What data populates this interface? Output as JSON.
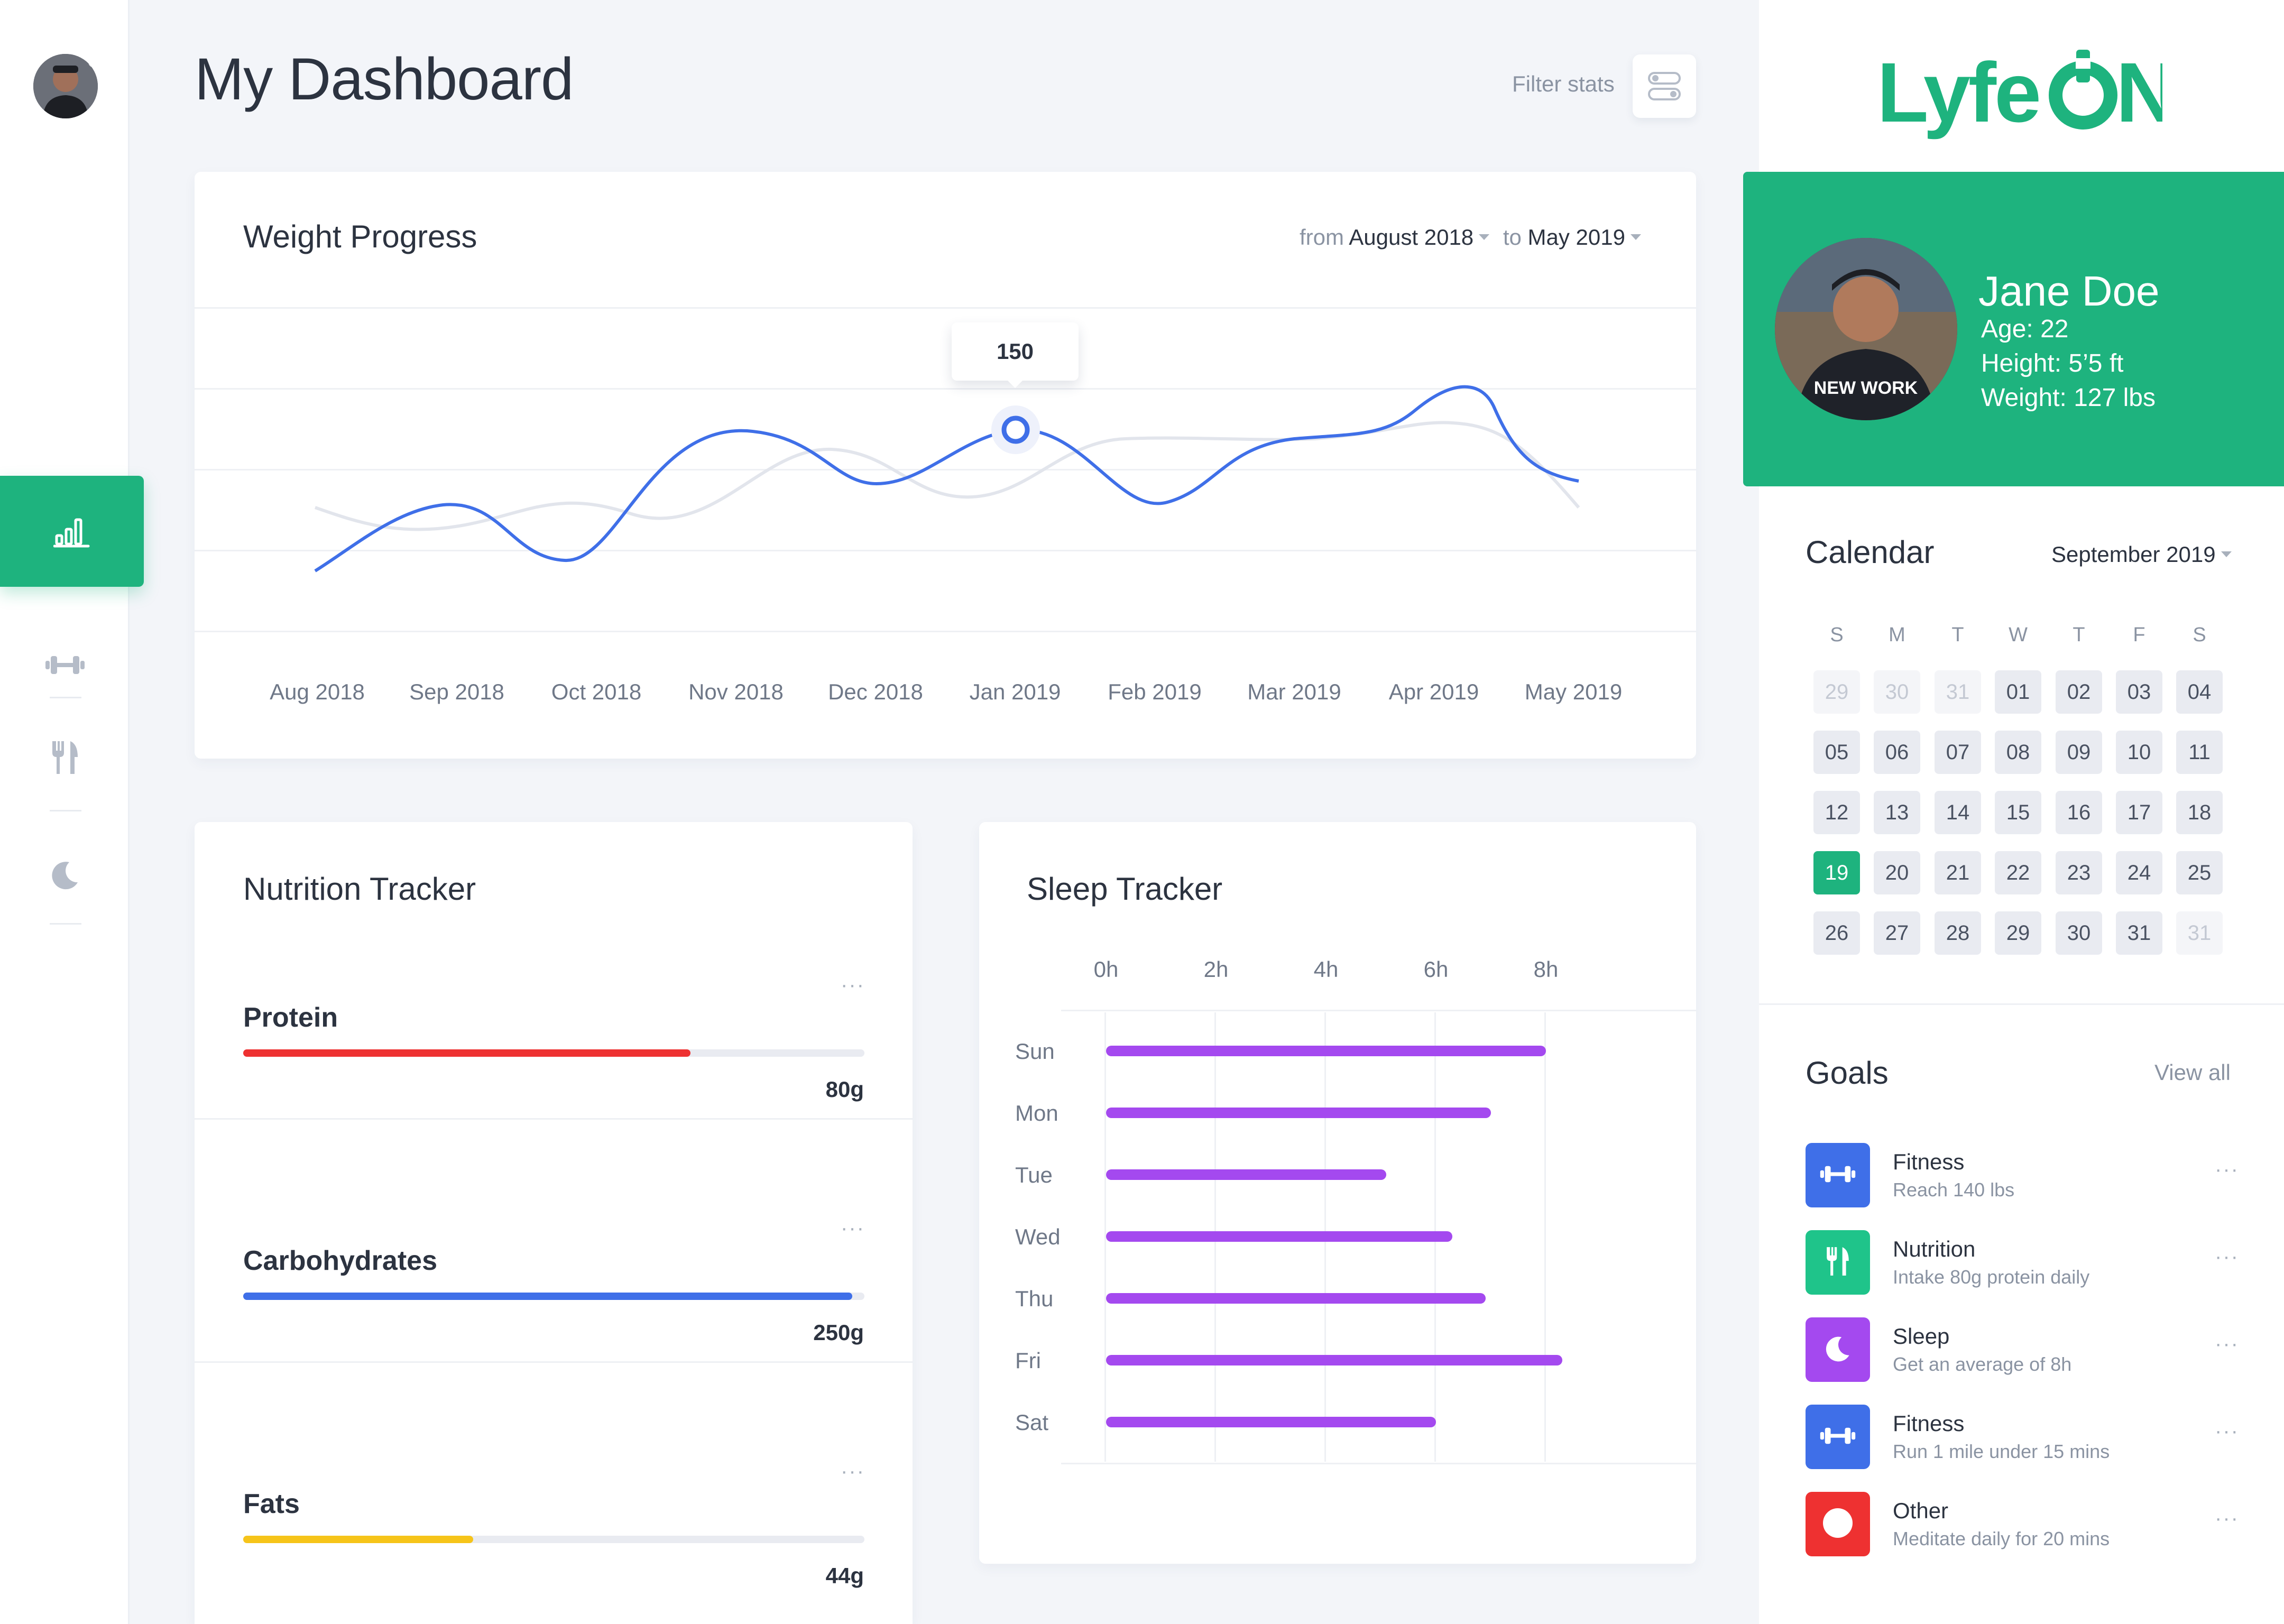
{
  "header": {
    "title": "My Dashboard",
    "filter_label": "Filter stats"
  },
  "rail": {
    "items": [
      "stats-icon",
      "dumbbell-icon",
      "fork-knife-icon",
      "moon-icon"
    ]
  },
  "weight": {
    "title": "Weight Progress",
    "from_label": "from",
    "from_value": "August 2018",
    "to_label": "to",
    "to_value": "May 2019",
    "tooltip": "150",
    "months": [
      "Aug 2018",
      "Sep 2018",
      "Oct 2018",
      "Nov 2018",
      "Dec 2018",
      "Jan 2019",
      "Feb 2019",
      "Mar 2019",
      "Apr 2019",
      "May 2019"
    ]
  },
  "nutrition": {
    "title": "Nutrition Tracker",
    "items": [
      {
        "name": "Protein",
        "value": "80g",
        "fraction": 0.72,
        "color": "#ee3131"
      },
      {
        "name": "Carbohydrates",
        "value": "250g",
        "fraction": 0.98,
        "color": "#3f6fe8"
      },
      {
        "name": "Fats",
        "value": "44g",
        "fraction": 0.37,
        "color": "#f6c41a"
      }
    ],
    "menu_glyph": "···"
  },
  "sleep": {
    "title": "Sleep Tracker",
    "hours": [
      "0h",
      "2h",
      "4h",
      "6h",
      "8h"
    ],
    "days": [
      "Sun",
      "Mon",
      "Tue",
      "Wed",
      "Thu",
      "Fri",
      "Sat"
    ],
    "values_h": [
      8.0,
      7.0,
      5.1,
      6.3,
      6.9,
      8.3,
      6.0
    ],
    "bar_color": "#a449ef"
  },
  "brand": {
    "logo_text": "LyfeON",
    "color": "#1eb37e"
  },
  "profile": {
    "name": "Jane Doe",
    "age": "Age: 22",
    "height": "Height: 5’5 ft",
    "weight": "Weight: 127 lbs",
    "shirt_text": "NEW WORK"
  },
  "calendar": {
    "title": "Calendar",
    "month": "September 2019",
    "weekdays": [
      "S",
      "M",
      "T",
      "W",
      "T",
      "F",
      "S"
    ],
    "weeks": [
      [
        {
          "d": "29",
          "m": 1
        },
        {
          "d": "30",
          "m": 1
        },
        {
          "d": "31",
          "m": 1
        },
        {
          "d": "01"
        },
        {
          "d": "02"
        },
        {
          "d": "03"
        },
        {
          "d": "04"
        }
      ],
      [
        {
          "d": "05"
        },
        {
          "d": "06"
        },
        {
          "d": "07"
        },
        {
          "d": "08"
        },
        {
          "d": "09"
        },
        {
          "d": "10"
        },
        {
          "d": "11"
        }
      ],
      [
        {
          "d": "12"
        },
        {
          "d": "13"
        },
        {
          "d": "14"
        },
        {
          "d": "15"
        },
        {
          "d": "16"
        },
        {
          "d": "17"
        },
        {
          "d": "18"
        }
      ],
      [
        {
          "d": "19",
          "t": 1
        },
        {
          "d": "20"
        },
        {
          "d": "21"
        },
        {
          "d": "22"
        },
        {
          "d": "23"
        },
        {
          "d": "24"
        },
        {
          "d": "25"
        }
      ],
      [
        {
          "d": "26"
        },
        {
          "d": "27"
        },
        {
          "d": "28"
        },
        {
          "d": "29"
        },
        {
          "d": "30"
        },
        {
          "d": "31"
        },
        {
          "d": "31",
          "m": 1
        }
      ]
    ]
  },
  "goals": {
    "title": "Goals",
    "view_all": "View all",
    "items": [
      {
        "title": "Fitness",
        "sub": "Reach 140 lbs",
        "icon": "dumbbell-icon",
        "color": "#3f6fe8"
      },
      {
        "title": "Nutrition",
        "sub": "Intake 80g protein daily",
        "icon": "fork-knife-icon",
        "color": "#1fc48a"
      },
      {
        "title": "Sleep",
        "sub": "Get an average of 8h",
        "icon": "moon-icon",
        "color": "#a449ef"
      },
      {
        "title": "Fitness",
        "sub": "Run 1 mile under 15 mins",
        "icon": "dumbbell-icon",
        "color": "#3f6fe8"
      },
      {
        "title": "Other",
        "sub": "Meditate daily for 20 mins",
        "icon": "circle-icon",
        "color": "#ee3131"
      }
    ]
  }
}
